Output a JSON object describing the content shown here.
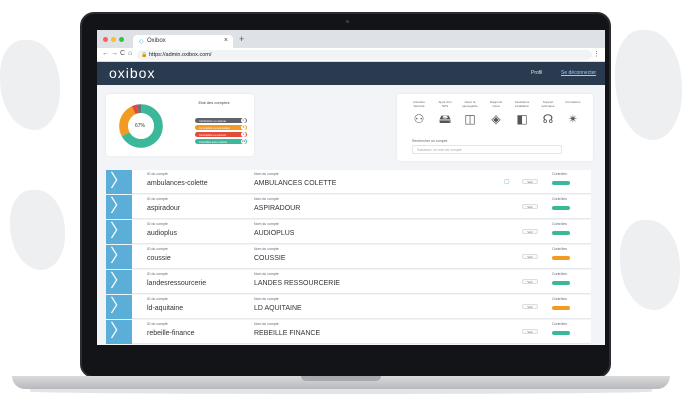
{
  "browser": {
    "tab_title": "Oxibox",
    "url": "https://admin.oxibox.com/",
    "new_tab": "+",
    "close_tab": "×",
    "back": "←",
    "forward": "→",
    "reload": "C",
    "home": "⌂",
    "menu": "⋮",
    "lock": "🔒",
    "favicon": "◇"
  },
  "app": {
    "logo": "oxibox",
    "nav": [
      {
        "label": "Profil",
        "active": false
      },
      {
        "label": "Se déconnecter",
        "active": true
      }
    ]
  },
  "status_card": {
    "title": "Etat des comptes",
    "percent_label": "67%",
    "donut": {
      "segments": [
        {
          "name": "green",
          "value": 67,
          "color": "#3bb89a"
        },
        {
          "name": "orange",
          "value": 26,
          "color": "#f29a22"
        },
        {
          "name": "red",
          "value": 4,
          "color": "#e24a3b"
        },
        {
          "name": "grey",
          "value": 3,
          "color": "#6d7176"
        }
      ]
    },
    "legend": [
      {
        "label": "Vérification en attente",
        "count": "1",
        "color": "#5f6368"
      },
      {
        "label": "Incomplets ou anomalies",
        "count": "5",
        "color": "#f29a22"
      },
      {
        "label": "Incomplets ou erreurs",
        "count": "1",
        "color": "#e24a3b"
      },
      {
        "label": "Contrôlés avec succès",
        "count": "23",
        "color": "#3bb89a"
      }
    ]
  },
  "services_card": {
    "services": [
      {
        "label": "Annuaire Sécurité",
        "icon": "user-lock-icon",
        "glyph": "⚇"
      },
      {
        "label": "Ajout d'un NPS",
        "icon": "server-icon",
        "glyph": "🖴"
      },
      {
        "label": "Gérer la sauvegarde",
        "icon": "camera-icon",
        "glyph": "◫"
      },
      {
        "label": "Rapports cloud",
        "icon": "diamond-icon",
        "glyph": "◈"
      },
      {
        "label": "Assistance installation",
        "icon": "book-icon",
        "glyph": "◧"
      },
      {
        "label": "Support technique",
        "icon": "headset-icon",
        "glyph": "☊"
      },
      {
        "label": "Formations",
        "icon": "person-icon",
        "glyph": "✴"
      }
    ],
    "search_label": "Rechercher un compte",
    "search_placeholder": "Saisissez un nom de compte"
  },
  "table": {
    "id_label": "ID du compte",
    "name_label": "Nom du compte",
    "control_label": "Contrôles",
    "button_label": "Voir",
    "arrow": "〉",
    "rows": [
      {
        "id": "ambulances-colette",
        "name": "AMBULANCES COLETTE",
        "status_color": "#3bb89a",
        "note": "▢"
      },
      {
        "id": "aspiradour",
        "name": "ASPIRADOUR",
        "status_color": "#3bb89a",
        "note": ""
      },
      {
        "id": "audioplus",
        "name": "AUDIOPLUS",
        "status_color": "#3bb89a",
        "note": ""
      },
      {
        "id": "coussie",
        "name": "COUSSIE",
        "status_color": "#f29a22",
        "note": ""
      },
      {
        "id": "landesressourcerie",
        "name": "LANDES RESSOURCERIE",
        "status_color": "#3bb89a",
        "note": ""
      },
      {
        "id": "ld-aquitaine",
        "name": "LD AQUITAINE",
        "status_color": "#f29a22",
        "note": ""
      },
      {
        "id": "rebeille-finance",
        "name": "REBEILLE FINANCE",
        "status_color": "#3bb89a",
        "note": ""
      }
    ]
  }
}
